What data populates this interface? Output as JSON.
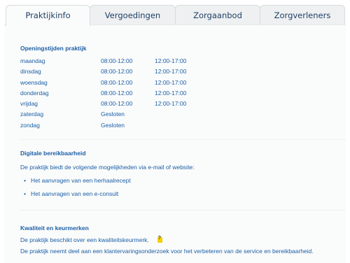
{
  "tabs": [
    {
      "label": "Praktijkinfo",
      "active": true
    },
    {
      "label": "Vergoedingen",
      "active": false
    },
    {
      "label": "Zorgaanbod",
      "active": false
    },
    {
      "label": "Zorgverleners",
      "active": false
    }
  ],
  "opening": {
    "heading": "Openingstijden praktijk",
    "days": [
      {
        "day": "maandag",
        "morning": "08:00-12:00",
        "afternoon": "12:00-17:00"
      },
      {
        "day": "dinsdag",
        "morning": "08:00-12:00",
        "afternoon": "12:00-17:00"
      },
      {
        "day": "woensdag",
        "morning": "08:00-12:00",
        "afternoon": "12:00-17:00"
      },
      {
        "day": "donderdag",
        "morning": "08:00-12:00",
        "afternoon": "12:00-17:00"
      },
      {
        "day": "vrijdag",
        "morning": "08:00-12:00",
        "afternoon": "12:00-17:00"
      },
      {
        "day": "zaterdag",
        "morning": "Gesloten",
        "afternoon": ""
      },
      {
        "day": "zondag",
        "morning": "Gesloten",
        "afternoon": ""
      }
    ]
  },
  "digital": {
    "heading": "Digitale bereikbaarheid",
    "intro": "De praktijk biedt de volgende mogelijkheden via e-mail of website:",
    "items": [
      "Het aanvragen van een herhaalrecept",
      "Het aanvragen van een e-consult"
    ]
  },
  "quality": {
    "heading": "Kwaliteit en keurmerken",
    "line1": "De praktijk beschikt over een kwaliteitskeurmerk.",
    "line2": "De praktijk neemt deel aan een klantervaringsonderzoek voor het verbeteren van de service en bereikbaarheid."
  },
  "colors": {
    "text": "#1b5fa5",
    "tab_text": "#1e3f66",
    "tab_bg": "#eef0f1",
    "info_icon": "#f6d000"
  }
}
